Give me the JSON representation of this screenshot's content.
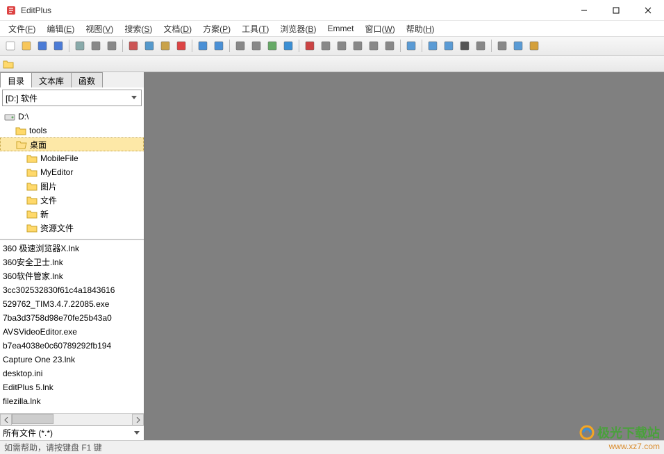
{
  "title": "EditPlus",
  "menu": [
    {
      "label": "文件(F)",
      "accel": "F"
    },
    {
      "label": "编辑(E)",
      "accel": "E"
    },
    {
      "label": "视图(V)",
      "accel": "V"
    },
    {
      "label": "搜索(S)",
      "accel": "S"
    },
    {
      "label": "文档(D)",
      "accel": "D"
    },
    {
      "label": "方案(P)",
      "accel": "P"
    },
    {
      "label": "工具(T)",
      "accel": "T"
    },
    {
      "label": "浏览器(B)",
      "accel": "B"
    },
    {
      "label": "Emmet",
      "accel": ""
    },
    {
      "label": "窗口(W)",
      "accel": "W"
    },
    {
      "label": "帮助(H)",
      "accel": "H"
    }
  ],
  "toolbar_icons": [
    "new-file-icon",
    "open-file-icon",
    "save-icon",
    "save-all-icon",
    "sep",
    "ftp-icon",
    "print-icon",
    "print-preview-icon",
    "sep",
    "cut-icon",
    "copy-icon",
    "paste-icon",
    "delete-icon",
    "sep",
    "undo-icon",
    "redo-icon",
    "sep",
    "find-icon",
    "replace-icon",
    "goto-icon",
    "bookmark-icon",
    "sep",
    "font-size-icon",
    "hex-icon",
    "word-wrap-icon",
    "line-number-icon",
    "ruler-icon",
    "special-chars-icon",
    "sep",
    "settings-icon",
    "sep",
    "browser-icon",
    "browser2-icon",
    "terminal-icon",
    "calculator-icon",
    "sep",
    "customize-icon",
    "arrow-tool-icon",
    "window-switch-icon"
  ],
  "sidebar": {
    "tabs": [
      {
        "id": "dir",
        "label": "目录",
        "active": true
      },
      {
        "id": "cliptext",
        "label": "文本库",
        "active": false
      },
      {
        "id": "functions",
        "label": "函数",
        "active": false
      }
    ],
    "drive": "[D:] 软件",
    "folders": [
      {
        "label": "D:\\",
        "indent": 0,
        "sel": false,
        "type": "drive"
      },
      {
        "label": "tools",
        "indent": 1,
        "sel": false,
        "type": "folder"
      },
      {
        "label": "桌面",
        "indent": 1,
        "sel": true,
        "type": "folder-open"
      },
      {
        "label": "MobileFile",
        "indent": 2,
        "sel": false,
        "type": "folder"
      },
      {
        "label": "MyEditor",
        "indent": 2,
        "sel": false,
        "type": "folder"
      },
      {
        "label": "图片",
        "indent": 2,
        "sel": false,
        "type": "folder"
      },
      {
        "label": "文件",
        "indent": 2,
        "sel": false,
        "type": "folder"
      },
      {
        "label": "新",
        "indent": 2,
        "sel": false,
        "type": "folder"
      },
      {
        "label": "资源文件",
        "indent": 2,
        "sel": false,
        "type": "folder"
      }
    ],
    "files": [
      "360 极速浏览器X.lnk",
      "360安全卫士.lnk",
      "360软件管家.lnk",
      "3cc302532830f61c4a1843616",
      "529762_TIM3.4.7.22085.exe",
      "7ba3d3758d98e70fe25b43a0",
      "AVSVideoEditor.exe",
      "b7ea4038e0c60789292fb194",
      "Capture One 23.lnk",
      "desktop.ini",
      "EditPlus 5.lnk",
      "filezilla.lnk"
    ],
    "filter": "所有文件 (*.*)"
  },
  "statusbar": "如需帮助，请按键盘 F1 键",
  "watermark": {
    "title": "极光下载站",
    "url": "www.xz7.com"
  }
}
